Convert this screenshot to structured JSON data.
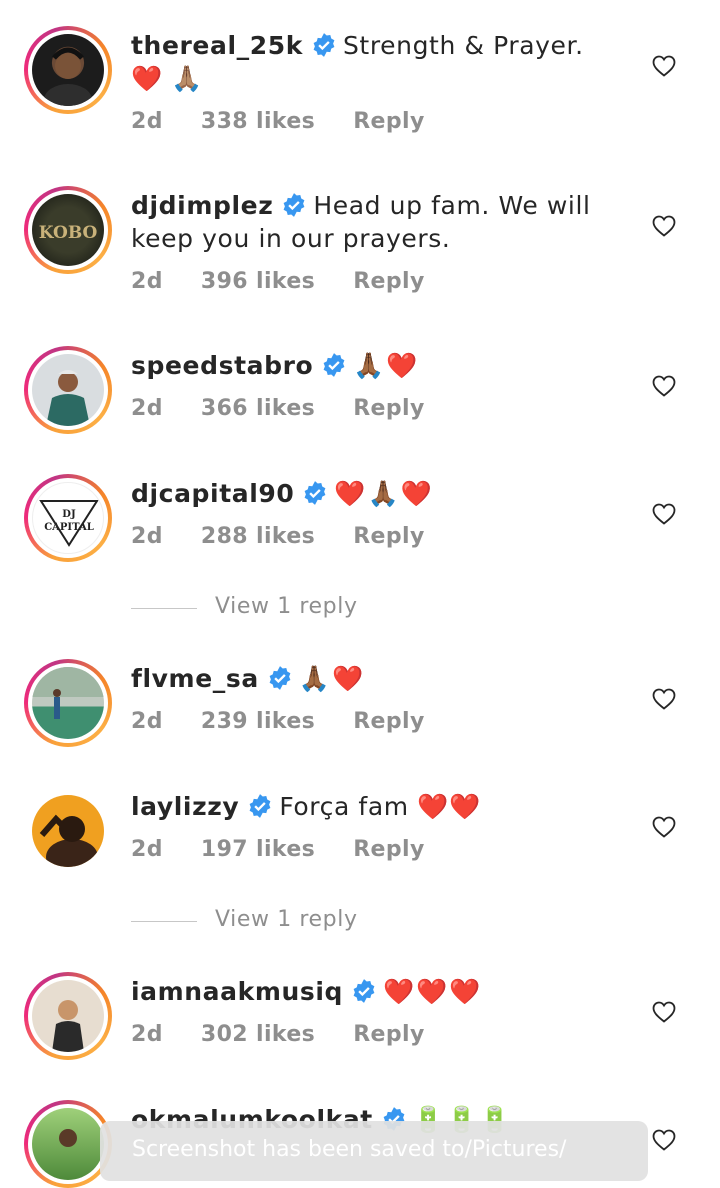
{
  "comments": [
    {
      "username": "thereal_25k",
      "text": "Strength & Prayer. ❤️ 🙏🏽",
      "time": "2d",
      "likes": "338 likes",
      "reply": "Reply"
    },
    {
      "username": "djdimplez",
      "text": "Head up fam. We will keep you in our prayers.",
      "time": "2d",
      "likes": "396 likes",
      "reply": "Reply"
    },
    {
      "username": "speedstabro",
      "text": "🙏🏾❤️",
      "time": "2d",
      "likes": "366 likes",
      "reply": "Reply"
    },
    {
      "username": "djcapital90",
      "text": "❤️🙏🏾❤️",
      "time": "2d",
      "likes": "288 likes",
      "reply": "Reply"
    },
    {
      "username": "flvme_sa",
      "text": "🙏🏾❤️",
      "time": "2d",
      "likes": "239 likes",
      "reply": "Reply"
    },
    {
      "username": "laylizzy",
      "text": "Força fam ❤️❤️",
      "time": "2d",
      "likes": "197 likes",
      "reply": "Reply"
    },
    {
      "username": "iamnaakmusiq",
      "text": "❤️❤️❤️",
      "time": "2d",
      "likes": "302 likes",
      "reply": "Reply"
    },
    {
      "username": "okmalumkoolkat",
      "text": "🔋🔋🔋",
      "time": "",
      "likes": "",
      "reply": ""
    }
  ],
  "view_replies": [
    "View 1 reply",
    "View 1 reply"
  ],
  "avatar_labels": {
    "djdimplez": "KOBO",
    "djcapital90_top": "DJ",
    "djcapital90_bottom": "CAPITAL"
  },
  "toast": "Screenshot has been saved to/Pictures/",
  "colors": {
    "verified": "#3897f0",
    "meta": "#8e8e8e",
    "heart_icon": "#262626"
  },
  "icons": {
    "like": "heart-outline-icon",
    "verified": "verified-badge-icon"
  }
}
